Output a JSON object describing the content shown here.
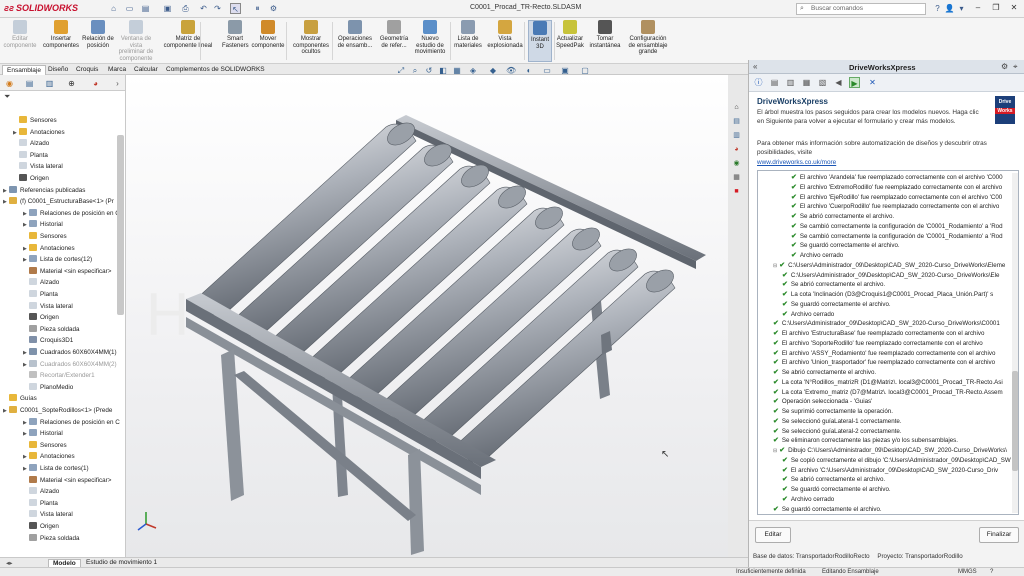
{
  "app": {
    "logo": "SOLIDWORKS",
    "doc_title": "C0001_Procad_TR-Recto.SLDASM",
    "search_placeholder": "Buscar comandos"
  },
  "ribbon": [
    {
      "label": "Editar componente",
      "disabled": true,
      "color": "#8aa0b8"
    },
    {
      "label": "Insertar componentes",
      "color": "#e0a030"
    },
    {
      "label": "Relación de posición",
      "color": "#6a8fbf"
    },
    {
      "label": "Ventana de vista preliminar de componente",
      "disabled": true,
      "color": "#8aa0b8"
    },
    {
      "label": "Matriz de componente lineal",
      "color": "#c9a33b"
    },
    {
      "label": "Smart Fasteners",
      "color": "#8b9aa8"
    },
    {
      "label": "Mover componente",
      "color": "#d08a2a"
    },
    {
      "label": "Mostrar componentes ocultos",
      "color": "#c8a040"
    },
    {
      "label": "Operaciones de ensamb...",
      "color": "#7d93ad"
    },
    {
      "label": "Geometría de refer...",
      "color": "#a0a0a0"
    },
    {
      "label": "Nuevo estudio de movimiento",
      "color": "#5b8fc9"
    },
    {
      "label": "Lista de materiales",
      "color": "#8a9bb0"
    },
    {
      "label": "Vista explosionada",
      "color": "#d4a640"
    },
    {
      "label": "Instant 3D",
      "active": true,
      "color": "#4a7ab5"
    },
    {
      "label": "Actualizar SpeedPak",
      "color": "#c7c33a"
    },
    {
      "label": "Tomar instantánea",
      "color": "#555555"
    },
    {
      "label": "Configuración de ensamblaje grande",
      "color": "#b09060"
    }
  ],
  "command_tabs": [
    "Ensamblaje",
    "Diseño",
    "Croquis",
    "Marca",
    "Calcular",
    "Complementos de SOLIDWORKS"
  ],
  "tree": [
    {
      "label": "Sensores",
      "indent": 1,
      "arrow": false,
      "icon": "#e8b73a"
    },
    {
      "label": "Anotaciones",
      "indent": 1,
      "arrow": true,
      "icon": "#e8b73a"
    },
    {
      "label": "Alzado",
      "indent": 1,
      "arrow": false,
      "icon": "#cfd6de"
    },
    {
      "label": "Planta",
      "indent": 1,
      "arrow": false,
      "icon": "#cfd6de"
    },
    {
      "label": "Vista lateral",
      "indent": 1,
      "arrow": false,
      "icon": "#cfd6de"
    },
    {
      "label": "Origen",
      "indent": 1,
      "arrow": false,
      "icon": "#555555"
    },
    {
      "label": "Referencias publicadas",
      "indent": 0,
      "arrow": true,
      "icon": "#7e95b0"
    },
    {
      "label": "(f) C0001_EstructuraBase<1> (Pr",
      "indent": 0,
      "arrow": true,
      "icon": "#e0b040"
    },
    {
      "label": "Relaciones de posición en C",
      "indent": 2,
      "arrow": true,
      "icon": "#8ea3bd"
    },
    {
      "label": "Historial",
      "indent": 2,
      "arrow": true,
      "icon": "#8ea3bd"
    },
    {
      "label": "Sensores",
      "indent": 2,
      "arrow": false,
      "icon": "#e8b73a"
    },
    {
      "label": "Anotaciones",
      "indent": 2,
      "arrow": true,
      "icon": "#e8b73a"
    },
    {
      "label": "Lista de cortes(12)",
      "indent": 2,
      "arrow": true,
      "icon": "#8ea3bd"
    },
    {
      "label": "Material <sin especificar>",
      "indent": 2,
      "arrow": false,
      "icon": "#b07a4a"
    },
    {
      "label": "Alzado",
      "indent": 2,
      "arrow": false,
      "icon": "#cfd6de"
    },
    {
      "label": "Planta",
      "indent": 2,
      "arrow": false,
      "icon": "#cfd6de"
    },
    {
      "label": "Vista lateral",
      "indent": 2,
      "arrow": false,
      "icon": "#cfd6de"
    },
    {
      "label": "Origen",
      "indent": 2,
      "arrow": false,
      "icon": "#555555"
    },
    {
      "label": "Pieza soldada",
      "indent": 2,
      "arrow": false,
      "icon": "#a0a0a0"
    },
    {
      "label": "Croquis3D1",
      "indent": 2,
      "arrow": false,
      "icon": "#8090a8"
    },
    {
      "label": "Cuadrados 60X60X4MM(1)",
      "indent": 2,
      "arrow": true,
      "icon": "#7f93ab"
    },
    {
      "label": "Cuadrados 60X60X4MM(2)",
      "indent": 2,
      "arrow": true,
      "icon": "#b8c2cd",
      "grey": true
    },
    {
      "label": "Recortar/Extender1",
      "indent": 2,
      "arrow": false,
      "icon": "#c0c0c0",
      "grey": true
    },
    {
      "label": "PlanoMedio",
      "indent": 2,
      "arrow": false,
      "icon": "#cfd6de"
    },
    {
      "label": "Guías",
      "indent": 0,
      "arrow": false,
      "icon": "#e8b73a"
    },
    {
      "label": "C0001_SopteRodillos<1> (Prede",
      "indent": 0,
      "arrow": true,
      "icon": "#e0b040"
    },
    {
      "label": "Relaciones de posición en C",
      "indent": 2,
      "arrow": true,
      "icon": "#8ea3bd"
    },
    {
      "label": "Historial",
      "indent": 2,
      "arrow": true,
      "icon": "#8ea3bd"
    },
    {
      "label": "Sensores",
      "indent": 2,
      "arrow": false,
      "icon": "#e8b73a"
    },
    {
      "label": "Anotaciones",
      "indent": 2,
      "arrow": true,
      "icon": "#e8b73a"
    },
    {
      "label": "Lista de cortes(1)",
      "indent": 2,
      "arrow": true,
      "icon": "#8ea3bd"
    },
    {
      "label": "Material <sin especificar>",
      "indent": 2,
      "arrow": false,
      "icon": "#b07a4a"
    },
    {
      "label": "Alzado",
      "indent": 2,
      "arrow": false,
      "icon": "#cfd6de"
    },
    {
      "label": "Planta",
      "indent": 2,
      "arrow": false,
      "icon": "#cfd6de"
    },
    {
      "label": "Vista lateral",
      "indent": 2,
      "arrow": false,
      "icon": "#cfd6de"
    },
    {
      "label": "Origen",
      "indent": 2,
      "arrow": false,
      "icon": "#555555"
    },
    {
      "label": "Pieza soldada",
      "indent": 2,
      "arrow": false,
      "icon": "#a0a0a0"
    }
  ],
  "bottom_tabs": [
    "Modelo",
    "Estudio de movimiento 1"
  ],
  "status": {
    "left": "Insuficientemente definida",
    "mode": "Editando Ensamblaje",
    "units": "MMGS"
  },
  "dw": {
    "panel_title": "DriveWorksXpress",
    "title": "DriveWorksXpress",
    "desc": "El árbol muestra los pasos seguidos para crear los modelos nuevos. Haga clic en Siguiente para volver a ejecutar el formulario y crear más modelos.",
    "more": "Para obtener más información sobre automatización de diseños y descubrir otras posibilidades, visite",
    "link": "www.driveworks.co.uk/more",
    "badge_top": "Drive",
    "badge_bottom": "Works",
    "btn_edit": "Editar",
    "btn_finish": "Finalizar",
    "db": "Base de datos: TransportadorRodilloRecto",
    "project": "Proyecto: TransportadorRodillo"
  },
  "log": [
    {
      "t": "El archivo 'Arandela' fue reemplazado correctamente con el archivo 'C000",
      "i": 3
    },
    {
      "t": "El archivo 'ExtremoRodillo' fue reemplazado correctamente con el archivo",
      "i": 3
    },
    {
      "t": "El archivo 'EjeRodillo' fue reemplazado correctamente con el archivo 'C00",
      "i": 3
    },
    {
      "t": "El archivo 'CuerpoRodillo' fue reemplazado correctamente con el archivo",
      "i": 3
    },
    {
      "t": "Se abrió correctamente el archivo.",
      "i": 3
    },
    {
      "t": "Se cambió correctamente la configuración de 'C0001_Rodamiento' a 'Rod",
      "i": 3
    },
    {
      "t": "Se cambió correctamente la configuración de 'C0001_Rodamiento' a 'Rod",
      "i": 3
    },
    {
      "t": "Se guardó correctamente el archivo.",
      "i": 3
    },
    {
      "t": "Archivo cerrado",
      "i": 3
    },
    {
      "t": "C:\\Users\\Administrador_09\\Desktop\\CAD_SW_2020-Curso_DriveWorks\\Eleme",
      "i": 1,
      "exp": true
    },
    {
      "t": "C:\\Users\\Administrador_09\\Desktop\\CAD_SW_2020-Curso_DriveWorks\\Ele",
      "i": 2
    },
    {
      "t": "Se abrió correctamente el archivo.",
      "i": 2
    },
    {
      "t": "La cota 'Inclinación (D3@Croquis1@C0001_Procad_Placa_Unión.Part)' s",
      "i": 2
    },
    {
      "t": "Se guardó correctamente el archivo.",
      "i": 2
    },
    {
      "t": "Archivo cerrado",
      "i": 2
    },
    {
      "t": "C:\\Users\\Administrador_09\\Desktop\\CAD_SW_2020-Curso_DriveWorks\\C0001",
      "i": 1
    },
    {
      "t": "El archivo 'EstructuraBase' fue reemplazado correctamente con el archivo",
      "i": 1
    },
    {
      "t": "El archivo 'SoporteRodillo' fue reemplazado correctamente con el archivo",
      "i": 1
    },
    {
      "t": "El archivo 'ASSY_Rodamiento' fue reemplazado correctamente con el archivo",
      "i": 1
    },
    {
      "t": "El archivo 'Union_trasportador' fue reemplazado correctamente con el archivo",
      "i": 1
    },
    {
      "t": "Se abrió correctamente el archivo.",
      "i": 1
    },
    {
      "t": "La cota 'N°Rodillos_matrizR (D1@Matriz\\. local3@C0001_Procad_TR-Recto.Asi",
      "i": 1
    },
    {
      "t": "La cota 'Extremo_matriz (D7@Matriz\\. local3@C0001_Procad_TR-Recto.Assem",
      "i": 1
    },
    {
      "t": "Operación seleccionada - 'Guias'",
      "i": 1
    },
    {
      "t": "Se suprimió correctamente la operación.",
      "i": 1
    },
    {
      "t": "Se seleccionó guíaLateral-1 correctamente.",
      "i": 1
    },
    {
      "t": "Se seleccionó guíaLateral-2 correctamente.",
      "i": 1
    },
    {
      "t": "Se eliminaron correctamente las piezas y/o los subensamblajes.",
      "i": 1
    },
    {
      "t": "Dibujo C:\\Users\\Administrador_09\\Desktop\\CAD_SW_2020-Curso_DriveWorks\\",
      "i": 1,
      "exp": true
    },
    {
      "t": "Se copió correctamente el dibujo 'C:\\Users\\Administrador_09\\Desktop\\CAD_SW",
      "i": 2
    },
    {
      "t": "El archivo 'C:\\Users\\Administrador_09\\Desktop\\CAD_SW_2020-Curso_Driv",
      "i": 2
    },
    {
      "t": "Se abrió correctamente el archivo.",
      "i": 2
    },
    {
      "t": "Se guardó correctamente el archivo.",
      "i": 2
    },
    {
      "t": "Archivo cerrado",
      "i": 2
    },
    {
      "t": "Se guardó correctamente el archivo.",
      "i": 1
    }
  ]
}
